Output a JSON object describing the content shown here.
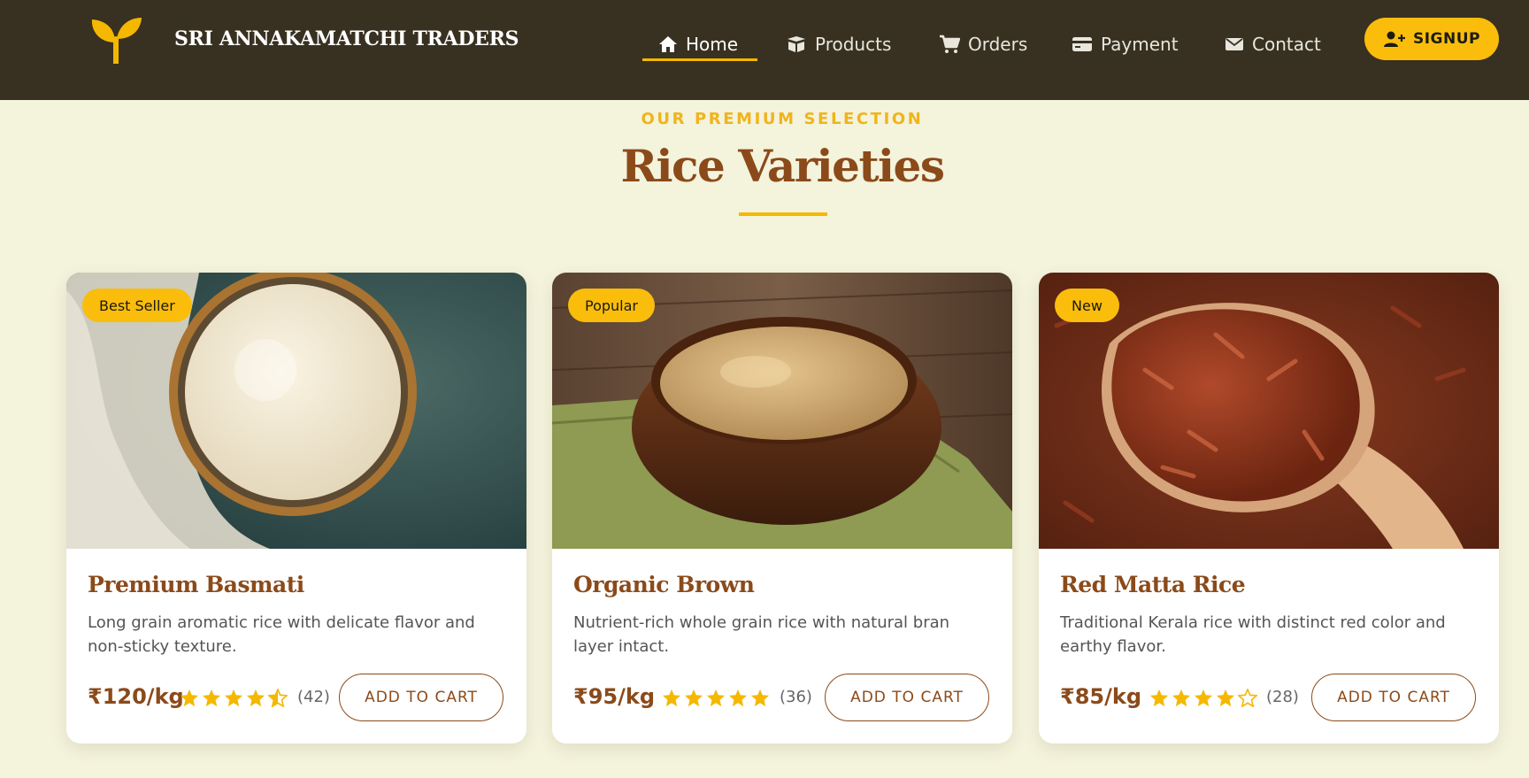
{
  "brand": {
    "name": "SRI ANNAKAMATCHI TRADERS",
    "accent_color": "#fbbd0c",
    "header_color": "#383121"
  },
  "nav": [
    {
      "label": "Home",
      "icon": "home-icon",
      "active": true
    },
    {
      "label": "Products",
      "icon": "box-icon",
      "active": false
    },
    {
      "label": "Orders",
      "icon": "cart-icon",
      "active": false
    },
    {
      "label": "Payment",
      "icon": "credit-card-icon",
      "active": false
    },
    {
      "label": "Contact",
      "icon": "envelope-icon",
      "active": false
    }
  ],
  "signup": {
    "label": "SIGNUP",
    "icon": "user-plus-icon"
  },
  "section": {
    "eyebrow": "OUR PREMIUM SELECTION",
    "title": "Rice Varieties",
    "title_color": "#8b4a1a"
  },
  "products": [
    {
      "badge": "Best Seller",
      "name": "Premium Basmati",
      "description": "Long grain aromatic rice with delicate flavor and non-sticky texture.",
      "price": "₹120/kg",
      "rating": 4.5,
      "reviews": "(42)",
      "button": "ADD TO CART",
      "image": "white-basmati-rice-in-bowl-photo"
    },
    {
      "badge": "Popular",
      "name": "Organic Brown",
      "description": "Nutrient-rich whole grain rice with natural bran layer intact.",
      "price": "₹95/kg",
      "rating": 5,
      "reviews": "(36)",
      "button": "ADD TO CART",
      "image": "brown-rice-in-wooden-bowl-photo"
    },
    {
      "badge": "New",
      "name": "Red Matta Rice",
      "description": "Traditional Kerala rice with distinct red color and earthy flavor.",
      "price": "₹85/kg",
      "rating": 4,
      "reviews": "(28)",
      "button": "ADD TO CART",
      "image": "red-rice-on-wooden-spoon-photo"
    }
  ]
}
